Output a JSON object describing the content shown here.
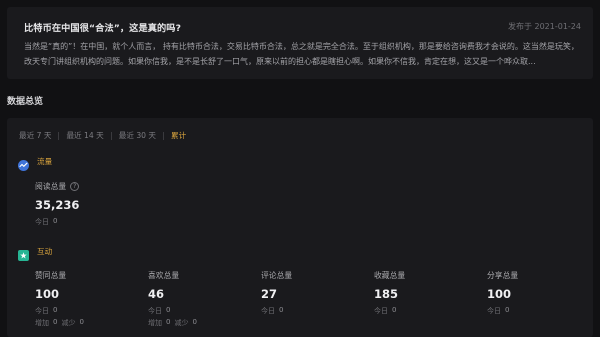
{
  "article": {
    "title": "比特币在中国很“合法”，这是真的吗?",
    "date_label": "发布于 2021-01-24",
    "excerpt": "当然是“真的”！在中国，就个人而言， 持有比特币合法，交易比特币合法，总之就是完全合法。至于组织机构，那是要给咨询费我才会说的。这当然是玩笑，改天专门讲组织机构的问题。如果你信我，是不是长舒了一口气，原来以前的担心都是瞎担心啊。如果你不信我，肯定在想，这又是一个哗众取..."
  },
  "section_title": "数据总览",
  "range_tabs": [
    {
      "label": "最近 7 天",
      "active": false
    },
    {
      "label": "最近 14 天",
      "active": false
    },
    {
      "label": "最近 30 天",
      "active": false
    },
    {
      "label": "累计",
      "active": true
    }
  ],
  "traffic": {
    "label": "流量",
    "icon": "traffic-icon",
    "read_total": {
      "label": "阅读总量",
      "value": "35,236",
      "today_label": "今日",
      "today": "0"
    }
  },
  "interaction": {
    "label": "互动",
    "icon": "interaction-icon",
    "metrics": [
      {
        "label": "赞同总量",
        "value": "100",
        "today_label": "今日",
        "today": "0",
        "add_label": "增加",
        "add": "0",
        "sub_label": "减少",
        "sub": "0"
      },
      {
        "label": "喜欢总量",
        "value": "46",
        "today_label": "今日",
        "today": "0",
        "add_label": "增加",
        "add": "0",
        "sub_label": "减少",
        "sub": "0"
      },
      {
        "label": "评论总量",
        "value": "27",
        "today_label": "今日",
        "today": "0"
      },
      {
        "label": "收藏总量",
        "value": "185",
        "today_label": "今日",
        "today": "0"
      },
      {
        "label": "分享总量",
        "value": "100",
        "today_label": "今日",
        "today": "0"
      }
    ]
  },
  "colors": {
    "accent": "#d6a23d",
    "traffic_icon": "#3f74d9",
    "interaction_icon": "#27b594"
  }
}
